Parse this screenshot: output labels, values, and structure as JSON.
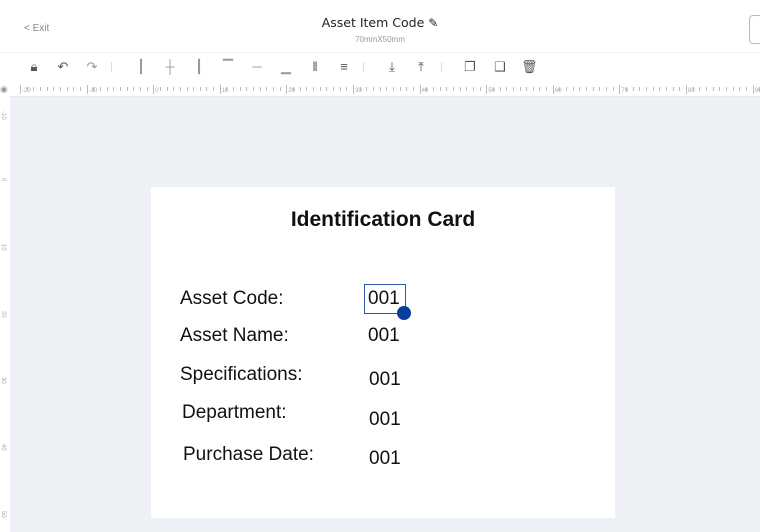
{
  "header": {
    "exit_label": "< Exit",
    "title": "Asset Item Code",
    "edit_icon": "edit-icon",
    "size": "70mmX50mm"
  },
  "toolbar": {
    "icons": [
      "lock-icon",
      "undo-icon",
      "redo-icon",
      "align-left-icon",
      "align-center-h-icon",
      "align-right-icon",
      "align-top-icon",
      "align-middle-v-icon",
      "align-bottom-icon",
      "distribute-h-icon",
      "distribute-v-icon",
      "move-down-layer-icon",
      "move-up-layer-icon",
      "copy-icon",
      "duplicate-icon",
      "delete-icon"
    ]
  },
  "ruler": {
    "top_labels": [
      "-20",
      "-10",
      "0",
      "10",
      "20",
      "30",
      "40",
      "50",
      "60",
      "70",
      "80",
      "90"
    ],
    "left_labels": [
      "-10",
      "0",
      "10",
      "20",
      "30",
      "40",
      "50"
    ]
  },
  "card": {
    "title": "Identification Card",
    "rows": [
      {
        "label": "Asset Code:",
        "value": "001"
      },
      {
        "label": "Asset Name:",
        "value": "001"
      },
      {
        "label": "Specifications:",
        "value": "001"
      },
      {
        "label": "Department:",
        "value": "001"
      },
      {
        "label": "Purchase Date:",
        "value": "001"
      }
    ]
  },
  "colors": {
    "selection": "#3355aa",
    "handle": "#0a3f99",
    "canvas": "#edf1f5"
  }
}
